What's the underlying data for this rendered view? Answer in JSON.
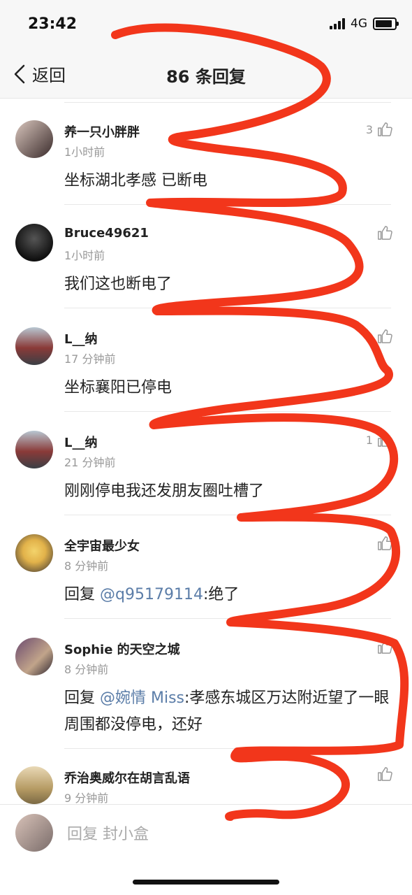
{
  "status_bar": {
    "time": "23:42",
    "network": "4G"
  },
  "header": {
    "back_label": "返回",
    "title": "86 条回复"
  },
  "comments": [
    {
      "name": "养一只小胖胖",
      "time": "1小时前",
      "text": "坐标湖北孝感 已断电",
      "likes": "3"
    },
    {
      "name": "Bruce49621",
      "time": "1小时前",
      "text": "我们这也断电了",
      "likes": ""
    },
    {
      "name": "L__纳",
      "time": "17 分钟前",
      "text": "坐标襄阳已停电",
      "likes": ""
    },
    {
      "name": "L__纳",
      "time": "21 分钟前",
      "text": "刚刚停电我还发朋友圈吐槽了",
      "likes": "1"
    },
    {
      "name": "全宇宙最少女",
      "time": "8 分钟前",
      "reply_prefix": "回复 ",
      "mention": "@q95179114",
      "text": ":绝了",
      "likes": ""
    },
    {
      "name": "Sophie 的天空之城",
      "time": "8 分钟前",
      "reply_prefix": "回复 ",
      "mention": "@婉情 Miss",
      "text": ":孝感东城区万达附近望了一眼周围都没停电，还好",
      "likes": ""
    },
    {
      "name": "乔治奥威尔在胡言乱语",
      "time": "9 分钟前",
      "text": "",
      "likes": ""
    }
  ],
  "reply_bar": {
    "placeholder": "回复 封小盒"
  },
  "colors": {
    "scribble": "#f2361b",
    "mention": "#5b7da8",
    "meta": "#999999"
  }
}
